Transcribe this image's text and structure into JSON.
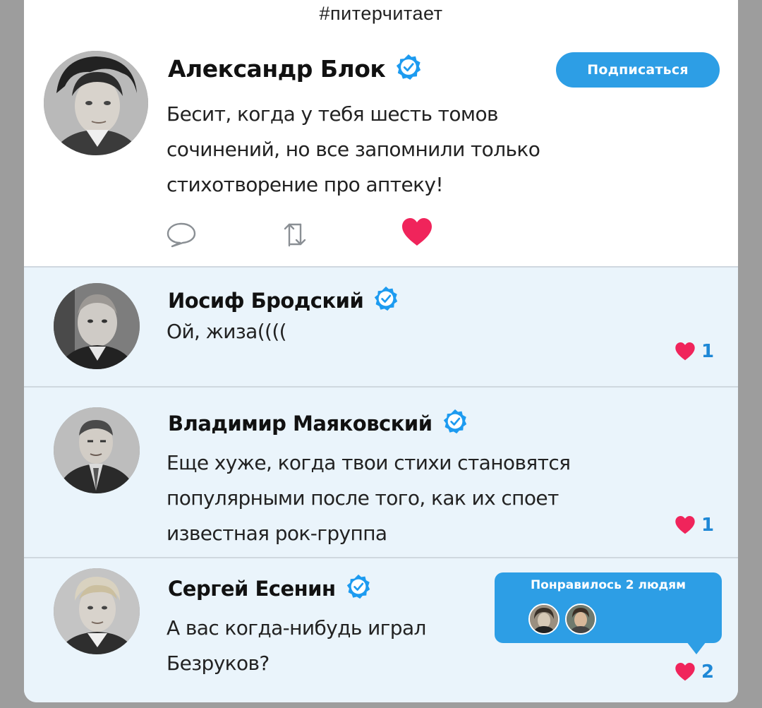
{
  "hashtag": "#питерчитает",
  "main_post": {
    "author": "Александр Блок",
    "verified": true,
    "subscribe_label": "Подписаться",
    "lines": [
      "Бесит, когда у тебя шесть томов",
      "сочинений, но все запомнили только",
      "стихотворение про аптеку!"
    ],
    "actions": [
      "comment-icon",
      "retweet-icon",
      "like-icon"
    ],
    "liked": true
  },
  "replies": [
    {
      "author": "Иосиф Бродский",
      "verified": true,
      "lines": [
        "Ой, жиза(((("
      ],
      "likes": "1"
    },
    {
      "author": "Владимир Маяковский",
      "verified": true,
      "lines": [
        "Еще хуже, когда твои стихи становятся",
        "популярными после того, как их споет",
        "известная рок-группа"
      ],
      "likes": "1"
    },
    {
      "author": "Сергей Есенин",
      "verified": true,
      "lines": [
        "А вас когда-нибудь играл",
        "Безруков?"
      ],
      "likes": "2",
      "liked_by_popup": {
        "title": "Понравилось 2 людям"
      }
    }
  ],
  "colors": {
    "accent": "#2d9ee5",
    "like": "#f0245b",
    "reply_bg": "#eaf4fb"
  }
}
